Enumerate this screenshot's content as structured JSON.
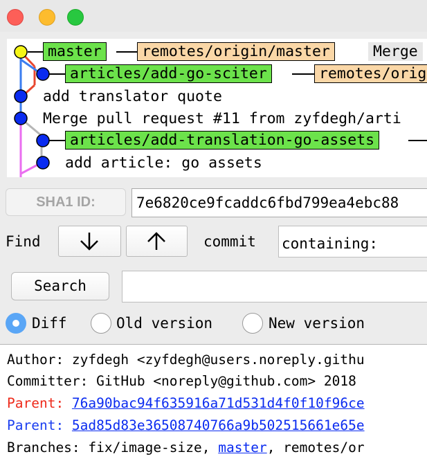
{
  "window": {
    "controls": [
      "close",
      "minimize",
      "zoom"
    ],
    "colors": {
      "close": "#fd5f58",
      "minimize": "#fdbc2e",
      "zoom": "#28c840"
    }
  },
  "graph": {
    "rows": [
      {
        "tags": [
          {
            "label": "master",
            "style": "green"
          },
          {
            "label": "remotes/origin/master",
            "style": "peach"
          }
        ],
        "message": "Merge"
      },
      {
        "tags": [
          {
            "label": "articles/add-go-sciter",
            "style": "green"
          },
          {
            "label": "remotes/orig",
            "style": "peach"
          }
        ]
      },
      {
        "message": "add translator quote"
      },
      {
        "message": "Merge pull request #11 from zyfdegh/arti"
      },
      {
        "tags": [
          {
            "label": "articles/add-translation-go-assets",
            "style": "green"
          }
        ]
      },
      {
        "message": "add article: go assets"
      }
    ],
    "colors": {
      "head_node": "#f5f516",
      "node": "#0a2bf0",
      "line_red": "#e8462e",
      "line_blue": "#3b7df0",
      "line_grey": "#b6b6b6",
      "line_pink": "#ea6ef0"
    }
  },
  "sha": {
    "button_label": "SHA1 ID:",
    "value": "7e6820ce9fcaddc6fbd799ea4ebc88"
  },
  "find": {
    "label": "Find",
    "down_icon": "arrow-down-icon",
    "up_icon": "arrow-up-icon",
    "field_type": "commit",
    "mode_value": "containing:"
  },
  "search": {
    "button_label": "Search",
    "value": ""
  },
  "view_mode": {
    "options": [
      {
        "label": "Diff",
        "selected": true
      },
      {
        "label": "Old version",
        "selected": false
      },
      {
        "label": "New version",
        "selected": false
      }
    ]
  },
  "details": {
    "author": "Author: zyfdegh <zyfdegh@users.noreply.githu",
    "committer": "Committer: GitHub <noreply@github.com>  2018",
    "parent1": {
      "label": "Parent: ",
      "hash": "76a90bac94f635916a71d531d4f0f10f96ce"
    },
    "parent2": {
      "label": "Parent: ",
      "hash": "5ad85d83e36508740766a9b502515661e65e"
    },
    "branches": {
      "prefix": "Branches: fix/image-size, ",
      "link": "master",
      "suffix": ", remotes/or"
    },
    "colors": {
      "parent1": "#ee2a1b",
      "parent2": "#1b3ef0",
      "link": "#0a2bf0"
    }
  }
}
